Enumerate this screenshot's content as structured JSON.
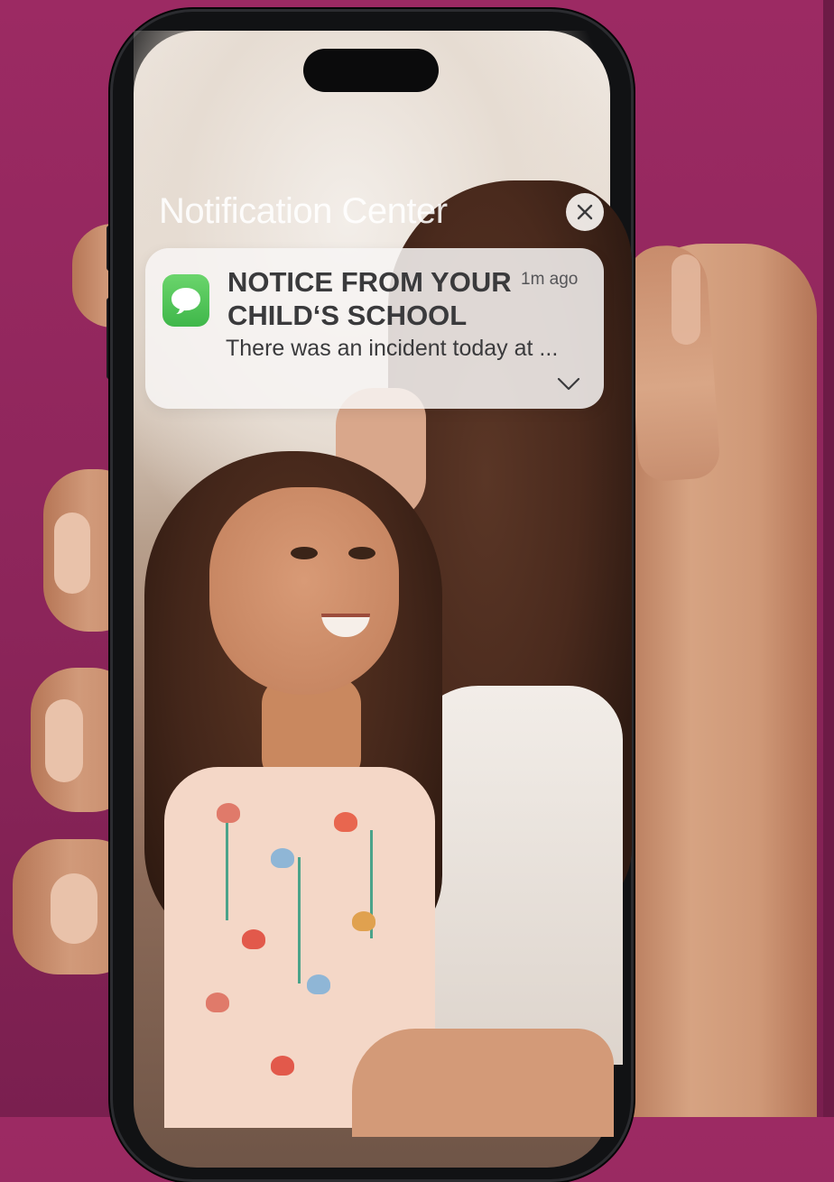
{
  "screen": {
    "title": "Notification Center"
  },
  "notification": {
    "app": "Messages",
    "title_line1": "NOTICE FROM YOUR",
    "title_line2": "CHILD‘S SCHOOL",
    "time": "1m ago",
    "body": "There was an incident today at ..."
  },
  "icons": {
    "close": "close-icon",
    "app": "messages-app-icon",
    "expand": "chevron-down-icon"
  },
  "colors": {
    "background": "#9c2a63",
    "messages_green": "#4cc452",
    "card": "#f7f5f3"
  }
}
